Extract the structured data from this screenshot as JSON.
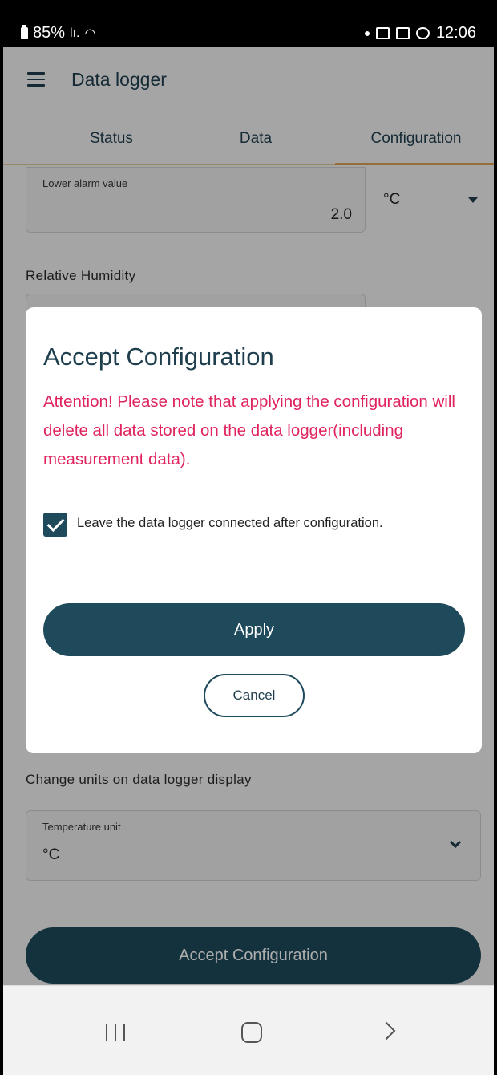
{
  "status_bar": {
    "battery": "85%",
    "signal": "lı.",
    "time": "12:06"
  },
  "app_bar": {
    "title": "Data logger"
  },
  "tabs": [
    {
      "label": "Status"
    },
    {
      "label": "Data"
    },
    {
      "label": "Configuration"
    }
  ],
  "form": {
    "lower_alarm": {
      "label": "Lower alarm value",
      "value": "2.0",
      "unit": "°C"
    },
    "section_humidity": "Relative Humidity",
    "section_display_units": "Change units on data logger display",
    "temperature_unit": {
      "label": "Temperature unit",
      "value": "°C"
    },
    "accept_button": "Accept Configuration"
  },
  "dialog": {
    "title": "Accept Configuration",
    "warning": "Attention! Please note that applying the configuration will delete all data stored on the data logger(including measurement data).",
    "checkbox_label": "Leave the data logger connected after configuration.",
    "checkbox_checked": true,
    "apply_button": "Apply",
    "cancel_button": "Cancel"
  },
  "colors": {
    "primary": "#1e4a5c",
    "warning": "#e0245e",
    "tab_indicator": "#e0a253"
  }
}
